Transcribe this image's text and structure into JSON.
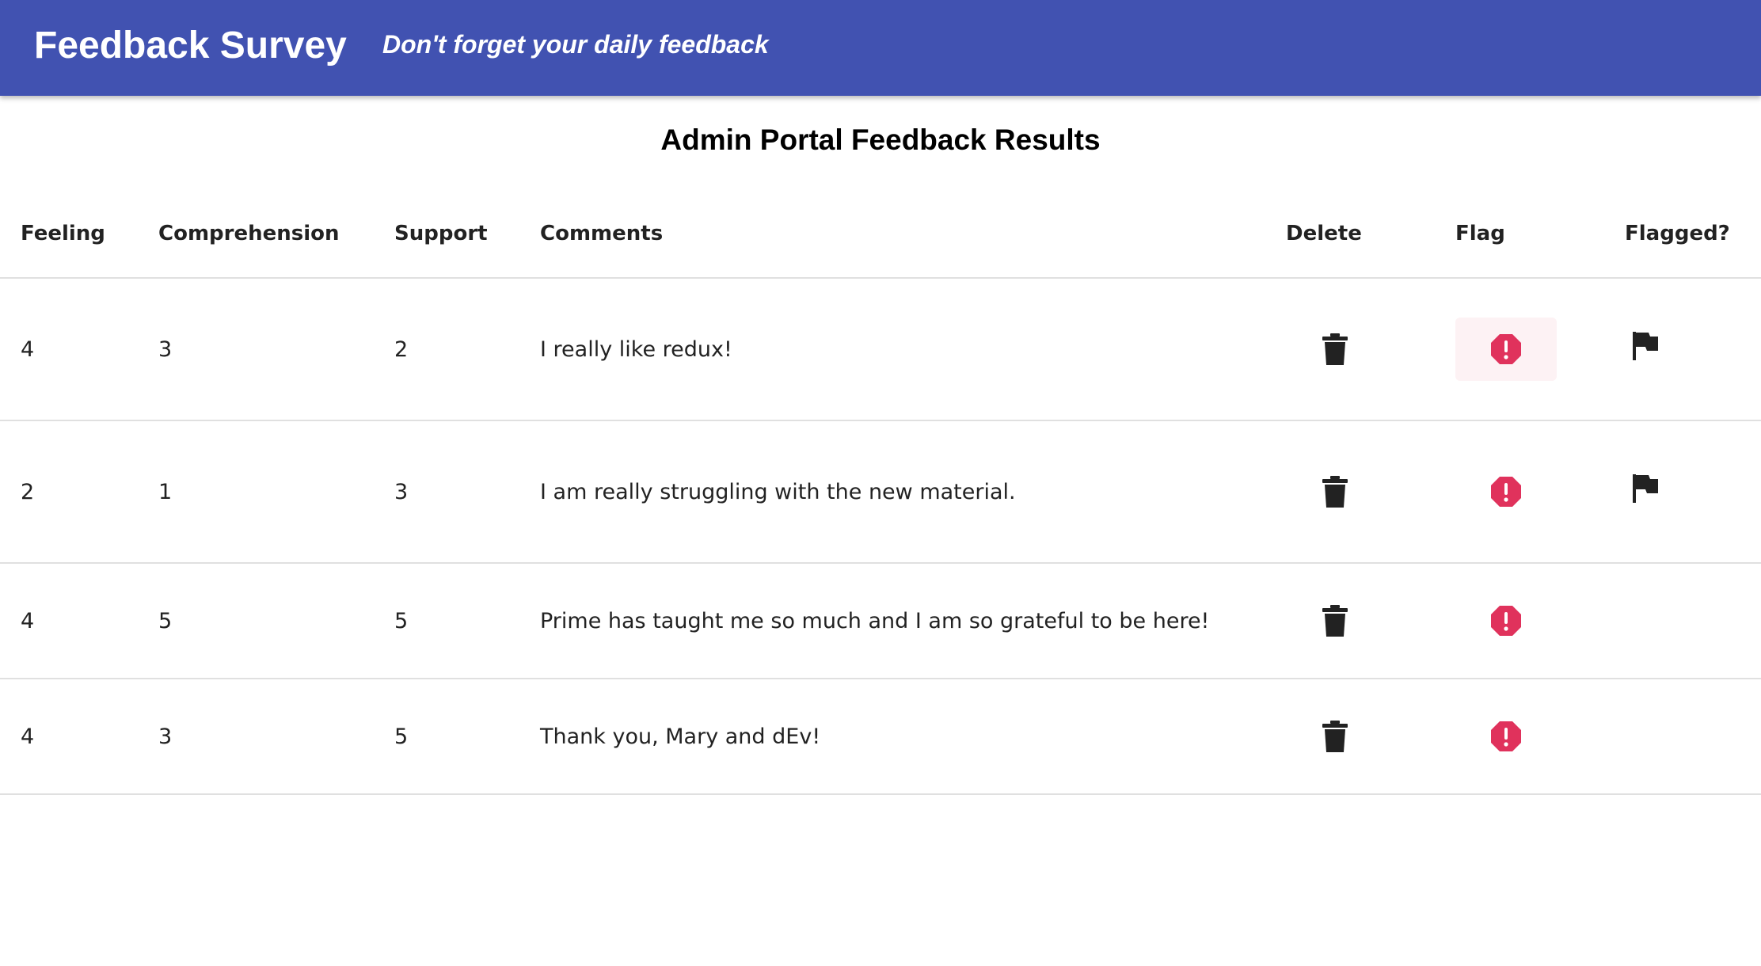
{
  "app": {
    "title": "Feedback Survey",
    "subtitle": "Don't forget your daily feedback",
    "bar_color": "#4152b1"
  },
  "page": {
    "title": "Admin Portal Feedback Results"
  },
  "table": {
    "headers": {
      "feeling": "Feeling",
      "comprehension": "Comprehension",
      "support": "Support",
      "comments": "Comments",
      "delete": "Delete",
      "flag": "Flag",
      "flagged": "Flagged?"
    },
    "rows": [
      {
        "feeling": "4",
        "comprehension": "3",
        "support": "2",
        "comments": "I really like redux!",
        "flagged": true
      },
      {
        "feeling": "2",
        "comprehension": "1",
        "support": "3",
        "comments": "I am really struggling with the new material.",
        "flagged": true
      },
      {
        "feeling": "4",
        "comprehension": "5",
        "support": "5",
        "comments": "Prime has taught me so much and I am so grateful to be here!",
        "flagged": false
      },
      {
        "feeling": "4",
        "comprehension": "3",
        "support": "5",
        "comments": "Thank you, Mary and dEv!",
        "flagged": false
      }
    ]
  },
  "icons": {
    "delete": "trash-icon",
    "flag": "error-octagon-icon",
    "flagged": "flag-icon"
  },
  "colors": {
    "flag_icon": "#e0325c",
    "delete_icon": "#222222",
    "flagged_icon": "#222222",
    "divider": "#e0e0e0"
  }
}
